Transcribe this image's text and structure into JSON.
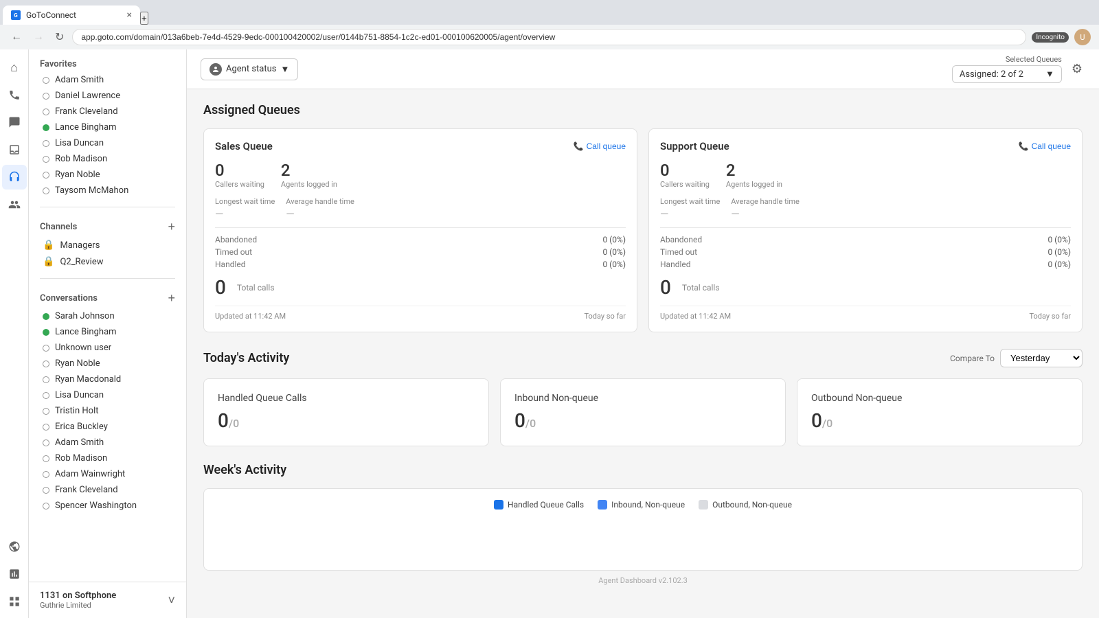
{
  "browser": {
    "tab_title": "GoToConnect",
    "address": "app.goto.com/domain/013a6beb-7e4d-4529-9edc-000100420002/user/0144b751-8854-1c2c-ed01-000100620005/agent/overview",
    "incognito_label": "Incognito"
  },
  "toolbar": {
    "agent_status_label": "Agent status",
    "selected_queues_label": "Selected Queues",
    "selected_queues_value": "Assigned: 2 of 2"
  },
  "sidebar": {
    "favorites_header": "Favorites",
    "favorites_items": [
      {
        "name": "Adam Smith",
        "status": "offline"
      },
      {
        "name": "Daniel Lawrence",
        "status": "offline"
      },
      {
        "name": "Frank Cleveland",
        "status": "offline"
      },
      {
        "name": "Lance Bingham",
        "status": "online"
      },
      {
        "name": "Lisa Duncan",
        "status": "offline"
      },
      {
        "name": "Rob Madison",
        "status": "offline"
      },
      {
        "name": "Ryan Noble",
        "status": "offline"
      },
      {
        "name": "Taysom McMahon",
        "status": "offline"
      }
    ],
    "channels_header": "Channels",
    "channel_items": [
      {
        "name": "Managers",
        "type": "channel"
      },
      {
        "name": "Q2_Review",
        "type": "channel"
      }
    ],
    "conversations_header": "Conversations",
    "conversation_items": [
      {
        "name": "Sarah Johnson",
        "status": "online"
      },
      {
        "name": "Lance Bingham",
        "status": "online"
      },
      {
        "name": "Unknown user",
        "status": "offline"
      },
      {
        "name": "Ryan Noble",
        "status": "offline"
      },
      {
        "name": "Ryan Macdonald",
        "status": "offline"
      },
      {
        "name": "Lisa Duncan",
        "status": "offline"
      },
      {
        "name": "Tristin Holt",
        "status": "offline"
      },
      {
        "name": "Erica Buckley",
        "status": "offline"
      },
      {
        "name": "Adam Smith",
        "status": "offline"
      },
      {
        "name": "Rob Madison",
        "status": "offline"
      },
      {
        "name": "Adam Wainwright",
        "status": "offline"
      },
      {
        "name": "Frank Cleveland",
        "status": "offline"
      },
      {
        "name": "Spencer Washington",
        "status": "offline"
      }
    ],
    "footer_phone": "1131 on Softphone",
    "footer_company": "Guthrie Limited"
  },
  "assigned_queues": {
    "title": "Assigned Queues",
    "sales_queue": {
      "title": "Sales Queue",
      "call_queue_label": "Call queue",
      "callers_waiting": "0",
      "callers_waiting_label": "Callers waiting",
      "agents_logged_in": "2",
      "agents_logged_in_label": "Agents logged in",
      "longest_wait_label": "Longest wait time",
      "average_handle_label": "Average handle time",
      "longest_wait_dash": "—",
      "average_handle_dash": "—",
      "abandoned_label": "Abandoned",
      "abandoned_value": "0 (0%)",
      "timed_out_label": "Timed out",
      "timed_out_value": "0 (0%)",
      "handled_label": "Handled",
      "handled_value": "0 (0%)",
      "total_calls": "0",
      "total_calls_label": "Total calls",
      "updated_label": "Updated at 11:42 AM",
      "period_label": "Today so far"
    },
    "support_queue": {
      "title": "Support Queue",
      "call_queue_label": "Call queue",
      "callers_waiting": "0",
      "callers_waiting_label": "Callers waiting",
      "agents_logged_in": "2",
      "agents_logged_in_label": "Agents logged in",
      "longest_wait_label": "Longest wait time",
      "average_handle_label": "Average handle time",
      "longest_wait_dash": "—",
      "average_handle_dash": "—",
      "abandoned_label": "Abandoned",
      "abandoned_value": "0 (0%)",
      "timed_out_label": "Timed out",
      "timed_out_value": "0 (0%)",
      "handled_label": "Handled",
      "handled_value": "0 (0%)",
      "total_calls": "0",
      "total_calls_label": "Total calls",
      "updated_label": "Updated at 11:42 AM",
      "period_label": "Today so far"
    }
  },
  "todays_activity": {
    "title": "Today's Activity",
    "compare_to_label": "Compare To",
    "compare_to_value": "Yesterday",
    "handled_queue_calls": {
      "title": "Handled Queue Calls",
      "value": "0",
      "secondary": "/0"
    },
    "inbound_non_queue": {
      "title": "Inbound Non-queue",
      "value": "0",
      "secondary": "/0"
    },
    "outbound_non_queue": {
      "title": "Outbound Non-queue",
      "value": "0",
      "secondary": "/0"
    }
  },
  "weeks_activity": {
    "title": "Week's Activity",
    "legend": [
      {
        "label": "Handled Queue Calls",
        "color": "#1a73e8"
      },
      {
        "label": "Inbound, Non-queue",
        "color": "#4285f4"
      },
      {
        "label": "Outbound, Non-queue",
        "color": "#dadce0"
      }
    ]
  },
  "footer": {
    "version": "Agent Dashboard v2.102.3"
  },
  "nav_icons": [
    {
      "name": "home-icon",
      "symbol": "⌂"
    },
    {
      "name": "phone-icon",
      "symbol": "📞"
    },
    {
      "name": "chat-icon",
      "symbol": "💬"
    },
    {
      "name": "inbox-icon",
      "symbol": "📥"
    },
    {
      "name": "headset-icon",
      "symbol": "🎧"
    },
    {
      "name": "people-icon",
      "symbol": "👥"
    },
    {
      "name": "globe-icon",
      "symbol": "🌐"
    },
    {
      "name": "chart-icon",
      "symbol": "📊"
    }
  ]
}
